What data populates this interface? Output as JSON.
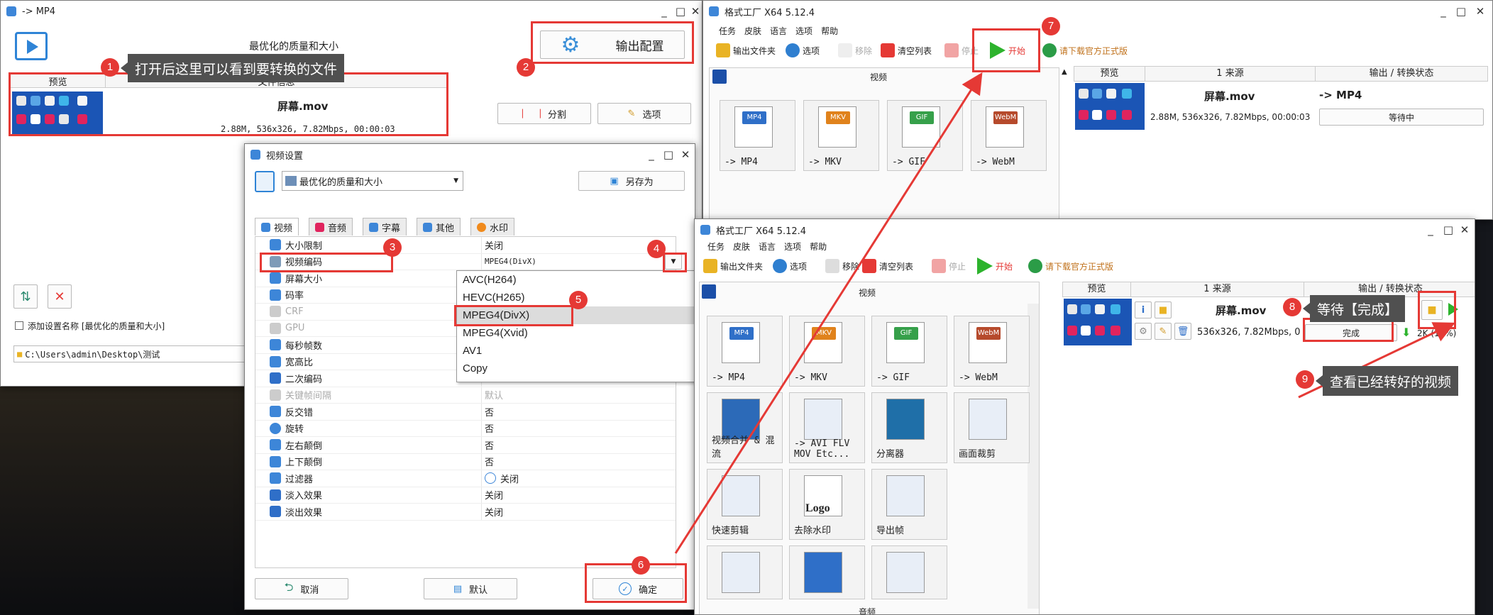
{
  "bg_colors": {
    "sky": "#3a6fa8",
    "dark": "#15171c"
  },
  "win_mp4": {
    "title": "-> MP4",
    "preset": "最优化的质量和大小",
    "output_config_label": "输出配置",
    "col_preview": "预览",
    "col_fileinfo": "文件信息",
    "file_name": "屏幕.mov",
    "file_meta": "2.88M, 536x326, 7.82Mbps, 00:00:03",
    "split_label": "分割",
    "options_label": "选项",
    "checkbox_label": "添加设置名称 [最优化的质量和大小]",
    "path": "C:\\Users\\admin\\Desktop\\测试"
  },
  "win_video": {
    "title": "视频设置",
    "preset": "最优化的质量和大小",
    "saveas_label": "另存为",
    "tabs": [
      "视频",
      "音频",
      "字幕",
      "其他",
      "水印"
    ],
    "rows": [
      {
        "label": "大小限制",
        "value": "关闭"
      },
      {
        "label": "视频编码",
        "value": "MPEG4(DivX)"
      },
      {
        "label": "屏幕大小",
        "value": ""
      },
      {
        "label": "码率",
        "value": ""
      },
      {
        "label": "CRF",
        "value": ""
      },
      {
        "label": "GPU",
        "value": ""
      },
      {
        "label": "每秒帧数",
        "value": ""
      },
      {
        "label": "宽高比",
        "value": ""
      },
      {
        "label": "二次编码",
        "value": ""
      },
      {
        "label": "关键帧间隔",
        "value": "默认"
      },
      {
        "label": "反交错",
        "value": "否"
      },
      {
        "label": "旋转",
        "value": "否"
      },
      {
        "label": "左右颠倒",
        "value": "否"
      },
      {
        "label": "上下颠倒",
        "value": "否"
      },
      {
        "label": "过滤器",
        "value": "关闭"
      },
      {
        "label": "淡入效果",
        "value": "关闭"
      },
      {
        "label": "淡出效果",
        "value": "关闭"
      }
    ],
    "dropdown": [
      "AVC(H264)",
      "HEVC(H265)",
      "MPEG4(DivX)",
      "MPEG4(Xvid)",
      "AV1",
      "Copy"
    ],
    "cancel_label": "取消",
    "default_label": "默认",
    "ok_label": "确定"
  },
  "win_ff1": {
    "title": "格式工厂 X64 5.12.4",
    "menu": [
      "任务",
      "皮肤",
      "语言",
      "选项",
      "帮助"
    ],
    "tools": [
      "输出文件夹",
      "选项",
      "移除",
      "清空列表",
      "停止",
      "开始",
      "请下载官方正式版"
    ],
    "section": "视频",
    "tiles": [
      "-> MP4",
      "-> MKV",
      "-> GIF",
      "-> WebM"
    ],
    "tile_tags": [
      "MP4",
      "MKV",
      "GIF",
      "WebM"
    ],
    "col_preview": "预览",
    "col_source": "1 来源",
    "col_status": "输出 / 转换状态",
    "file_name": "屏幕.mov",
    "file_meta": "2.88M, 536x326, 7.82Mbps, 00:00:03",
    "target": "-> MP4",
    "status": "等待中"
  },
  "win_ff2": {
    "title": "格式工厂 X64 5.12.4",
    "menu": [
      "任务",
      "皮肤",
      "语言",
      "选项",
      "帮助"
    ],
    "tools": [
      "输出文件夹",
      "选项",
      "移除",
      "清空列表",
      "停止",
      "开始",
      "请下载官方正式版"
    ],
    "section": "视频",
    "tiles": [
      "-> MP4",
      "-> MKV",
      "-> GIF",
      "-> WebM",
      "视频合并 & 混流",
      "-> AVI FLV MOV Etc...",
      "分离器",
      "画面裁剪",
      "快速剪辑",
      "去除水印",
      "导出帧"
    ],
    "tile_tags": [
      "MP4",
      "MKV",
      "GIF",
      "WebM"
    ],
    "logo_text": "Logo",
    "col_preview": "预览",
    "col_source": "1 来源",
    "col_status": "输出 / 转换状态",
    "file_name": "屏幕.mov",
    "file_meta": "536x326, 7.82Mbps, 0",
    "status": "完成",
    "progress_text": "2K (17%)",
    "progress_percent": 17,
    "section_bottom": "音频"
  },
  "callouts": {
    "c1": "打开后这里可以看到要转换的文件",
    "c8": "等待【完成】",
    "c9": "查看已经转好的视频"
  },
  "badges": [
    "1",
    "2",
    "3",
    "4",
    "5",
    "6",
    "7",
    "8",
    "9"
  ],
  "accent_red": "#e53935"
}
